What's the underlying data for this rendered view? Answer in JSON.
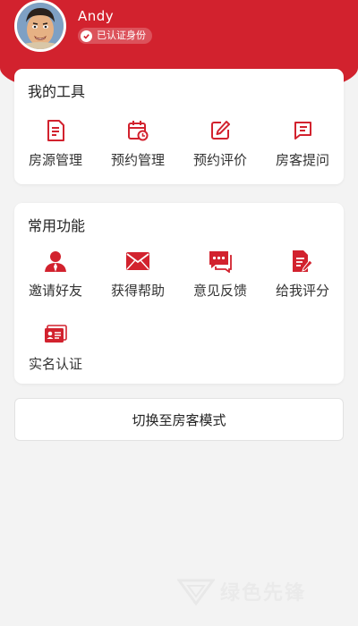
{
  "profile": {
    "username": "Andy",
    "verified_label": "已认证身份"
  },
  "tools": {
    "title": "我的工具",
    "items": [
      {
        "label": "房源管理",
        "icon": "document-list-icon"
      },
      {
        "label": "预约管理",
        "icon": "calendar-clock-icon"
      },
      {
        "label": "预约评价",
        "icon": "edit-review-icon"
      },
      {
        "label": "房客提问",
        "icon": "question-chat-icon"
      }
    ]
  },
  "common": {
    "title": "常用功能",
    "items": [
      {
        "label": "邀请好友",
        "icon": "user-icon"
      },
      {
        "label": "获得帮助",
        "icon": "mail-icon"
      },
      {
        "label": "意见反馈",
        "icon": "chat-bubble-icon"
      },
      {
        "label": "给我评分",
        "icon": "rating-doc-icon"
      },
      {
        "label": "实名认证",
        "icon": "id-card-icon"
      }
    ]
  },
  "switch_button": "切换至房客模式",
  "watermark": "绿色先锋",
  "colors": {
    "brand_red": "#d2222e",
    "background": "#f3f3f3",
    "card": "#ffffff"
  }
}
